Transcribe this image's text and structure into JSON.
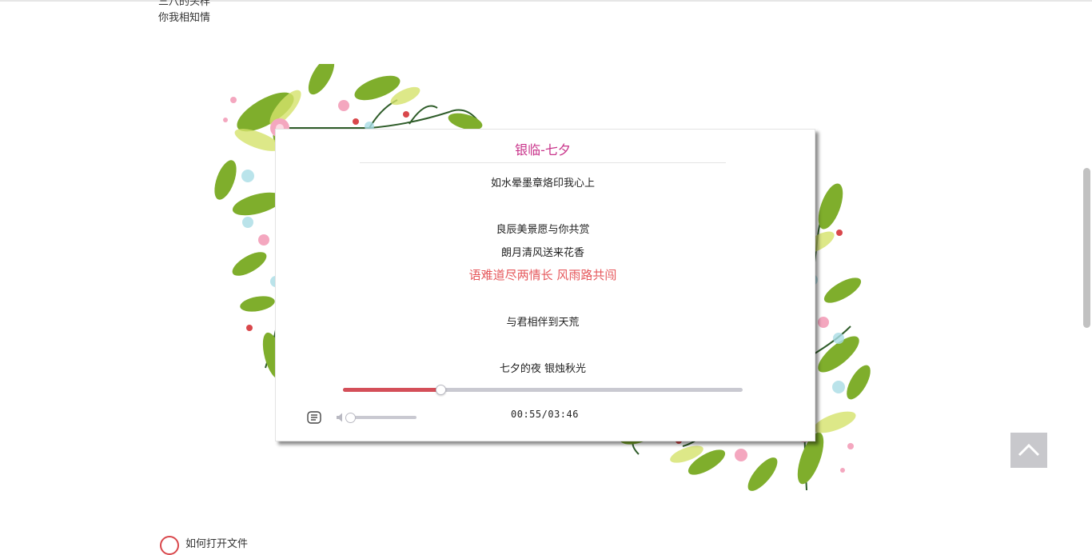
{
  "page": {
    "top_text_cut": "三八的头样",
    "top_text": "你我相知情",
    "bottom_text": "如何打开文件"
  },
  "player": {
    "title": "银临-七夕",
    "lyrics": [
      {
        "text": "如水晕墨章烙印我心上",
        "active": false
      },
      {
        "text": "良辰美景愿与你共赏",
        "active": false
      },
      {
        "text": "朗月清风送来花香",
        "active": false
      },
      {
        "text": "语难道尽两情长 风雨路共闯",
        "active": true
      },
      {
        "text": "与君相伴到天荒",
        "active": false
      },
      {
        "text": "七夕的夜 银烛秋光",
        "active": false
      }
    ],
    "progress": 0.243,
    "volume": 0.0,
    "time": "00:55/03:46",
    "icons": {
      "lyric_toggle": "lyric-toggle-icon",
      "volume": "speaker-icon",
      "back_to_top": "chevron-up-icon"
    }
  },
  "colors": {
    "title": "#c8338a",
    "active_lyric": "#e6585c",
    "progress": "#d44f59"
  }
}
